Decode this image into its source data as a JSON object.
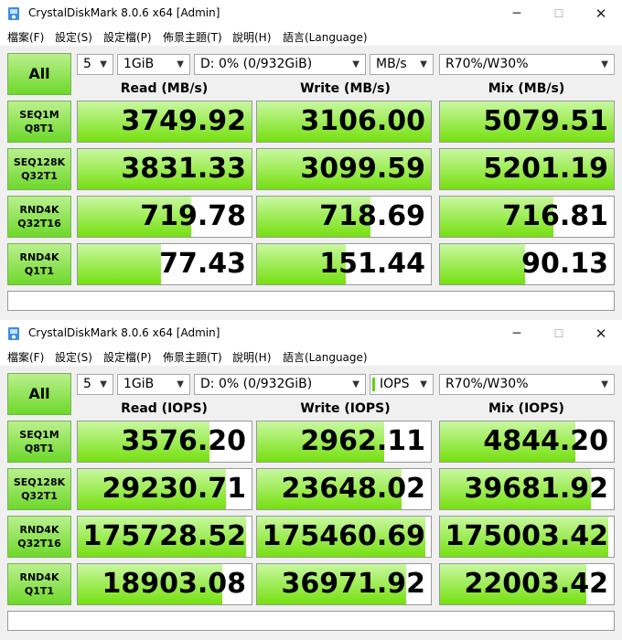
{
  "colors": {
    "accent_green": "#6ed82a",
    "bar_green": "#76e010"
  },
  "windows": [
    {
      "title": "CrystalDiskMark 8.0.6 x64 [Admin]",
      "icons": {
        "app": "crystaldiskmark-app-icon",
        "minimize": "minimize-icon",
        "maximize": "maximize-icon",
        "close": "close-icon"
      },
      "min_glyph": "─",
      "max_glyph": "☐",
      "close_glyph": "✕",
      "menu": [
        "檔案(F)",
        "設定(S)",
        "設定檔(P)",
        "佈景主題(T)",
        "說明(H)",
        "語言(Language)"
      ],
      "all_label": "All",
      "count": "5",
      "size": "1GiB",
      "drive": "D: 0% (0/932GiB)",
      "unit": "MB/s",
      "mix": "R70%/W30%",
      "headers": [
        "Read (MB/s)",
        "Write (MB/s)",
        "Mix (MB/s)"
      ],
      "rows": [
        {
          "l1": "SEQ1M",
          "l2": "Q8T1",
          "values": [
            "3749.92",
            "3106.00",
            "5079.51"
          ],
          "fill": [
            1.0,
            1.0,
            1.0
          ]
        },
        {
          "l1": "SEQ128K",
          "l2": "Q32T1",
          "values": [
            "3831.33",
            "3099.59",
            "5201.19"
          ],
          "fill": [
            1.0,
            1.0,
            1.0
          ]
        },
        {
          "l1": "RND4K",
          "l2": "Q32T16",
          "values": [
            "719.78",
            "718.69",
            "716.81"
          ],
          "fill": [
            0.65,
            0.65,
            0.65
          ]
        },
        {
          "l1": "RND4K",
          "l2": "Q1T1",
          "values": [
            "77.43",
            "151.44",
            "90.13"
          ],
          "fill": [
            0.48,
            0.51,
            0.49
          ]
        }
      ],
      "comment": ""
    },
    {
      "title": "CrystalDiskMark 8.0.6 x64 [Admin]",
      "icons": {
        "app": "crystaldiskmark-app-icon",
        "minimize": "minimize-icon",
        "maximize": "maximize-icon",
        "close": "close-icon"
      },
      "min_glyph": "─",
      "max_glyph": "☐",
      "close_glyph": "✕",
      "menu": [
        "檔案(F)",
        "設定(S)",
        "設定檔(P)",
        "佈景主題(T)",
        "說明(H)",
        "語言(Language)"
      ],
      "all_label": "All",
      "count": "5",
      "size": "1GiB",
      "drive": "D: 0% (0/932GiB)",
      "unit": "IOPS",
      "mix": "R70%/W30%",
      "headers": [
        "Read (IOPS)",
        "Write (IOPS)",
        "Mix (IOPS)"
      ],
      "rows": [
        {
          "l1": "SEQ1M",
          "l2": "Q8T1",
          "values": [
            "3576.20",
            "2962.11",
            "4844.20"
          ],
          "fill": [
            0.76,
            0.73,
            0.78
          ]
        },
        {
          "l1": "SEQ128K",
          "l2": "Q32T1",
          "values": [
            "29230.71",
            "23648.02",
            "39681.92"
          ],
          "fill": [
            0.85,
            0.83,
            0.87
          ]
        },
        {
          "l1": "RND4K",
          "l2": "Q32T16",
          "values": [
            "175728.52",
            "175460.69",
            "175003.42"
          ],
          "fill": [
            0.97,
            0.97,
            0.97
          ]
        },
        {
          "l1": "RND4K",
          "l2": "Q1T1",
          "values": [
            "18903.08",
            "36971.92",
            "22003.42"
          ],
          "fill": [
            0.83,
            0.86,
            0.84
          ]
        }
      ],
      "comment": ""
    }
  ]
}
